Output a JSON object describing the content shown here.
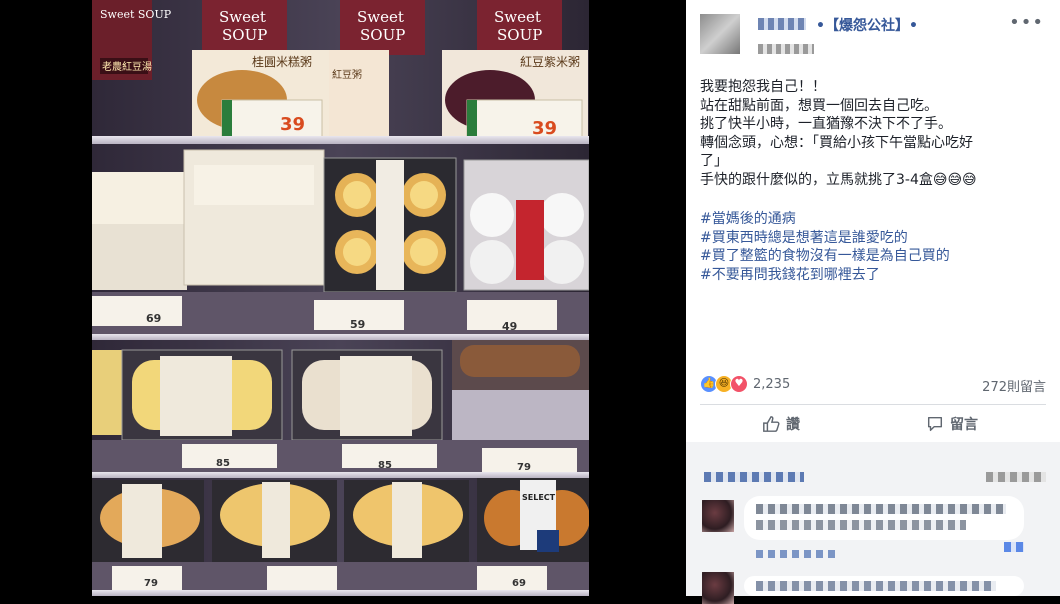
{
  "post": {
    "group_name": "•【爆怨公社】•",
    "more_label": "•••",
    "body_lines": [
      "我要抱怨我自己！！",
      "站在甜點前面，想買一個回去自己吃。",
      "挑了快半小時，一直猶豫不決下不了手。",
      "轉個念頭，心想：「買給小孩下午當點心吃好",
      "了」",
      "手快的跟什麼似的，立馬就挑了3-4盒😅😅😅"
    ],
    "hashtags": [
      "#當媽後的通病",
      "#買東西時總是想著這是誰愛吃的",
      "#買了整籃的食物沒有一樣是為自己買的",
      "#不要再問我錢花到哪裡去了"
    ]
  },
  "engagement": {
    "reaction_count": "2,235",
    "comment_count": "272則留言",
    "like_label": "讚",
    "comment_label": "留言"
  },
  "photo": {
    "product_labels": {
      "soup_brand": "Sweet SOUP",
      "soup_left": "桂圓米糕粥",
      "soup_right": "紅豆紫米粥",
      "red_bean": "老農紅豆湯",
      "red_soup": "紅豆粥",
      "price_soup": "39",
      "price_a": "69",
      "price_b": "59",
      "price_c": "49",
      "price_d": "85",
      "price_e": "85",
      "price_f": "79",
      "price_g": "79",
      "price_h": "69",
      "select_brand": "SELECT"
    }
  },
  "colors": {
    "link": "#365899",
    "text": "#1d2129",
    "muted": "#606770",
    "price": "#d94b1f"
  }
}
